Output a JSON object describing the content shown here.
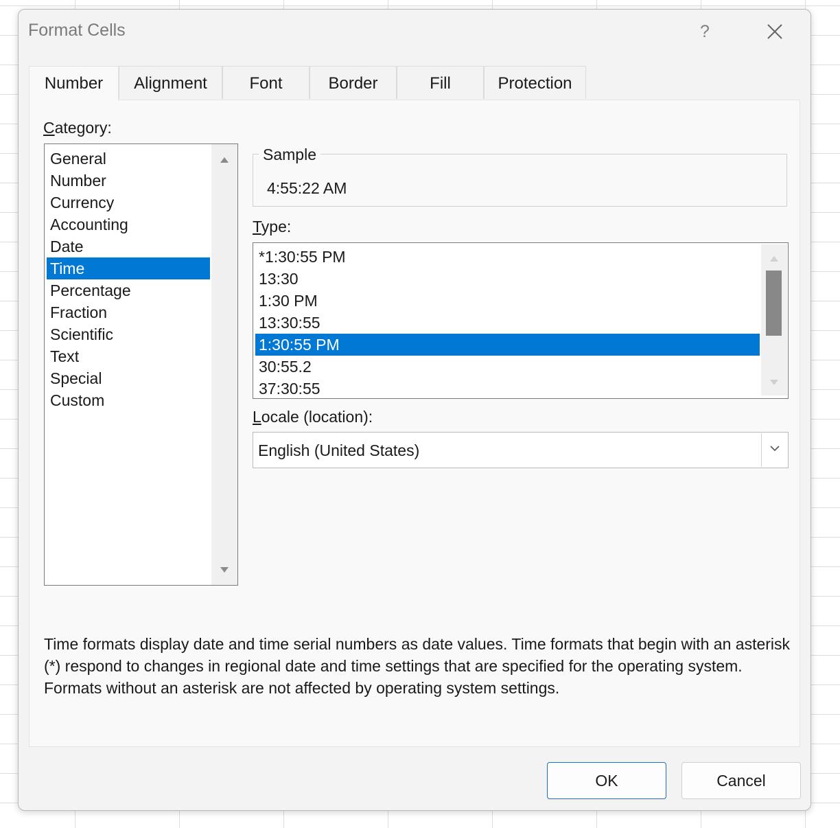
{
  "dialog": {
    "title": "Format Cells",
    "help_label": "?"
  },
  "tabs": [
    {
      "label": "Number",
      "active": true
    },
    {
      "label": "Alignment",
      "active": false
    },
    {
      "label": "Font",
      "active": false
    },
    {
      "label": "Border",
      "active": false
    },
    {
      "label": "Fill",
      "active": false
    },
    {
      "label": "Protection",
      "active": false
    }
  ],
  "category": {
    "label_first": "C",
    "label_rest": "ategory:",
    "items": [
      "General",
      "Number",
      "Currency",
      "Accounting",
      "Date",
      "Time",
      "Percentage",
      "Fraction",
      "Scientific",
      "Text",
      "Special",
      "Custom"
    ],
    "selected": "Time"
  },
  "sample": {
    "label": "Sample",
    "value": "4:55:22 AM"
  },
  "type": {
    "label_first": "T",
    "label_rest": "ype:",
    "items": [
      "*1:30:55 PM",
      "13:30",
      "1:30 PM",
      "13:30:55",
      "1:30:55 PM",
      "30:55.2",
      "37:30:55"
    ],
    "selected": "1:30:55 PM"
  },
  "locale": {
    "label_first": "L",
    "label_rest": "ocale (location):",
    "value": "English (United States)"
  },
  "description": "Time formats display date and time serial numbers as date values.  Time formats that begin with an asterisk (*) respond to changes in regional date and time settings that are specified for the operating system. Formats without an asterisk are not affected by operating system settings.",
  "buttons": {
    "ok": "OK",
    "cancel": "Cancel"
  },
  "colors": {
    "selection": "#0078d4",
    "ok_border": "#1e6fbf"
  },
  "icons": {
    "close": "close-icon",
    "dropdown": "chevron-down-icon",
    "scroll_up": "scroll-up-arrow-icon",
    "scroll_down": "scroll-down-arrow-icon"
  }
}
